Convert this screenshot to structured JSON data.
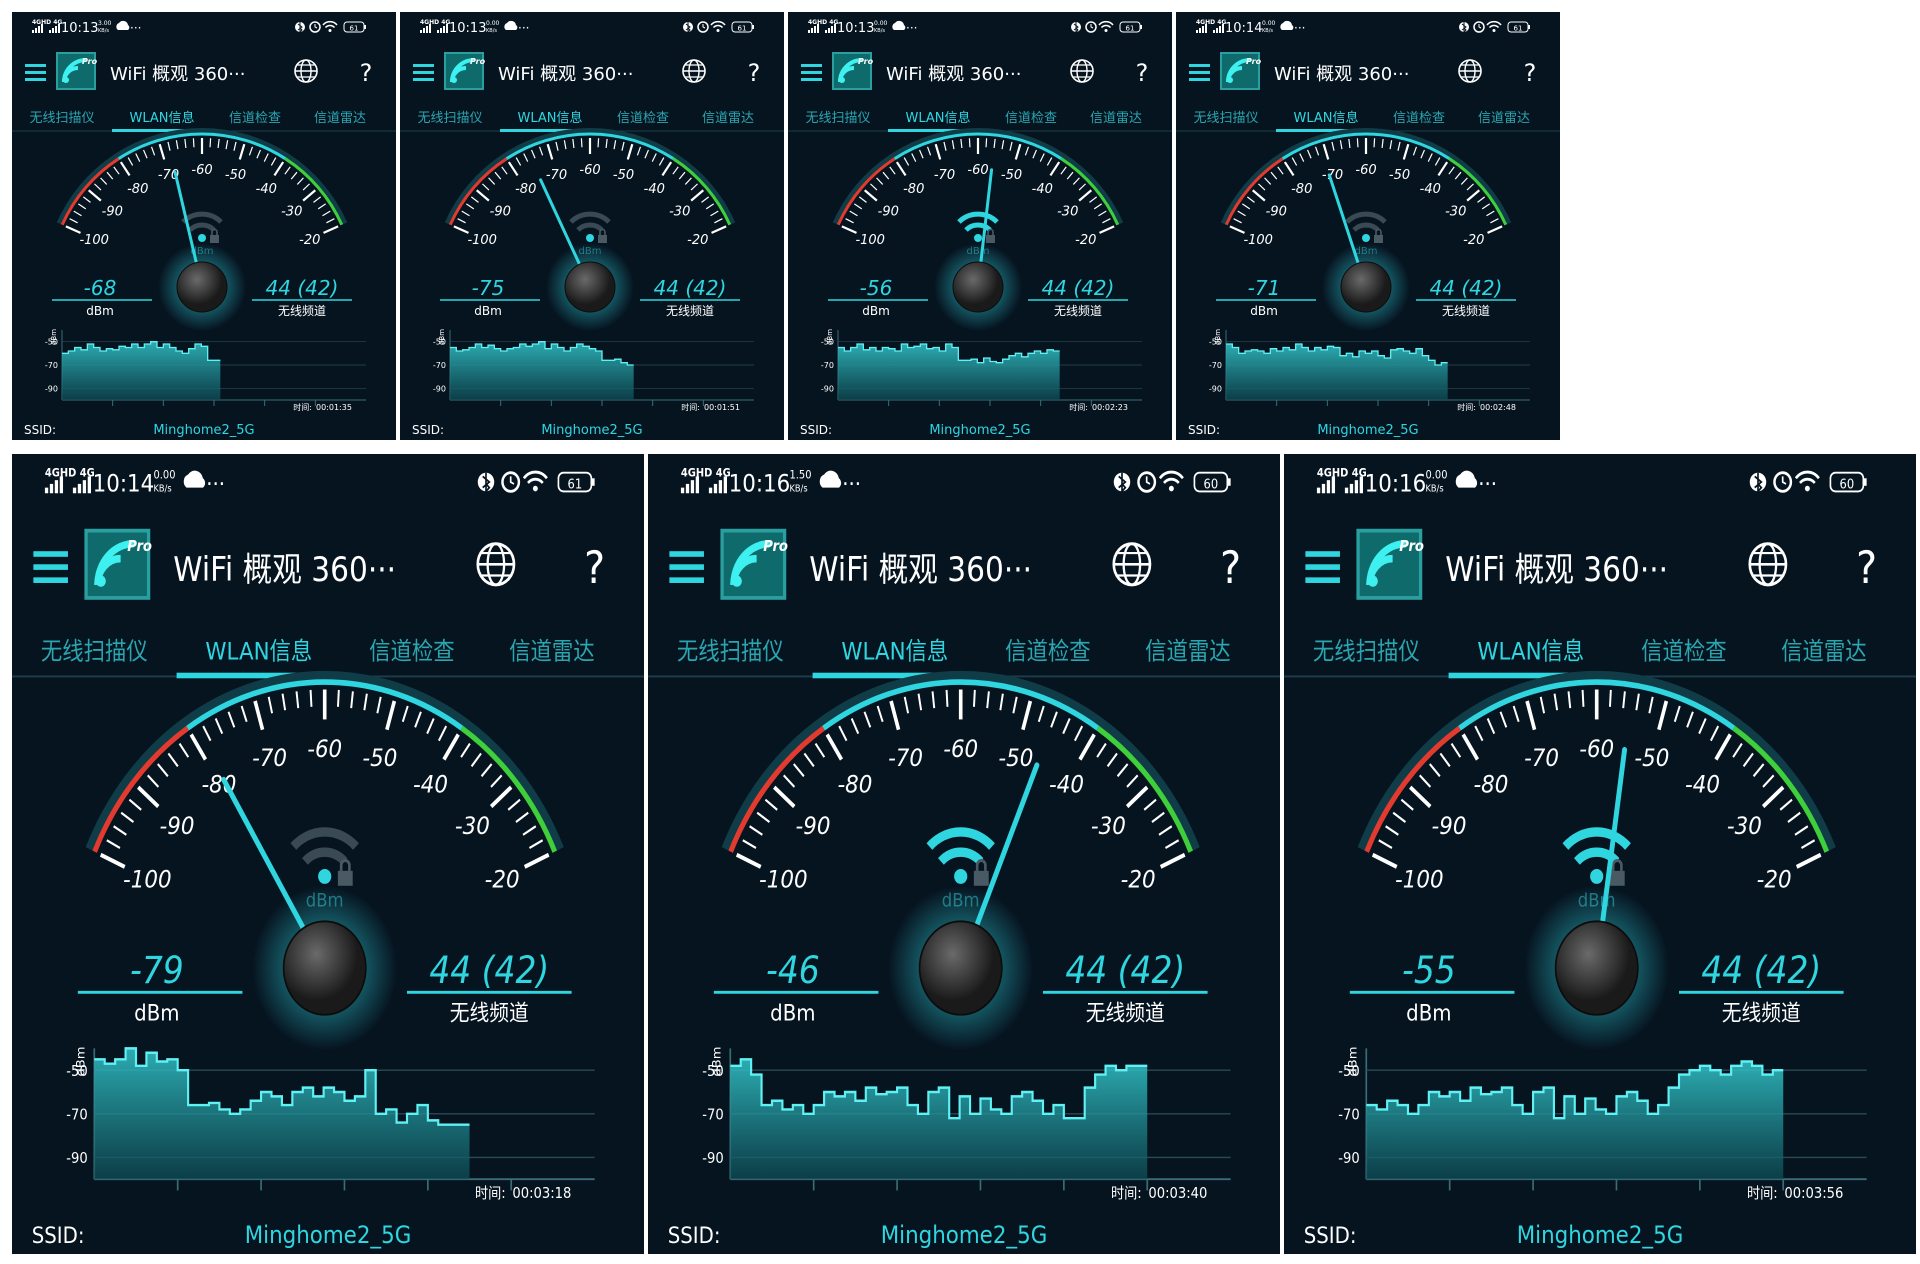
{
  "colors": {
    "bg": "#061420",
    "accent": "#2fd6e0",
    "red": "#e23a2e",
    "green": "#3ecf3a"
  },
  "app": {
    "title": "WiFi 概观 360···",
    "pro_badge": "Pro",
    "menu_icon": "hamburger-menu-icon",
    "globe_icon": "globe-icon",
    "help_label": "?",
    "tabs": [
      "无线扫描仪",
      "WLAN信息",
      "信道检查",
      "信道雷达"
    ],
    "active_tab": 1,
    "gauge_scale": [
      "-100",
      "-90",
      "-80",
      "-70",
      "-60",
      "-50",
      "-40",
      "-30",
      "-20"
    ],
    "gauge_unit": "dBm",
    "dbm_label": "dBm",
    "channel_label": "无线频道",
    "history_axis_unit": "dBm",
    "history_ticks": [
      "-50",
      "-70",
      "-90"
    ],
    "time_label": "时间:",
    "ssid_label": "SSID:",
    "ssid_value": "Minghome2_5G",
    "status_net": "4GHD 4G"
  },
  "panels": [
    {
      "time": "10:13",
      "speed": "3.00",
      "speed_unit": "KB/s",
      "battery": "61",
      "dbm": "-68",
      "channel": "44 (42)",
      "elapsed": "00:01:35",
      "wifi_level": 1,
      "history": [
        -60,
        -58,
        -55,
        -57,
        -52,
        -55,
        -58,
        -56,
        -57,
        -54,
        -55,
        -52,
        -55,
        -52,
        -50,
        -55,
        -52,
        -55,
        -58,
        -60,
        -56,
        -52,
        -54,
        -66,
        -66
      ]
    },
    {
      "time": "10:13",
      "speed": "0.00",
      "speed_unit": "KB/s",
      "battery": "61",
      "dbm": "-75",
      "channel": "44 (42)",
      "elapsed": "00:01:51",
      "wifi_level": 1,
      "history": [
        -55,
        -58,
        -57,
        -55,
        -52,
        -55,
        -53,
        -56,
        -58,
        -56,
        -55,
        -52,
        -54,
        -52,
        -50,
        -56,
        -52,
        -55,
        -58,
        -55,
        -52,
        -54,
        -56,
        -58,
        -66,
        -66,
        -65,
        -68,
        -70
      ]
    },
    {
      "time": "10:13",
      "speed": "0.00",
      "speed_unit": "KB/s",
      "battery": "61",
      "dbm": "-56",
      "channel": "44 (42)",
      "elapsed": "00:02:23",
      "wifi_level": 3,
      "history": [
        -55,
        -58,
        -55,
        -52,
        -57,
        -55,
        -58,
        -55,
        -56,
        -58,
        -52,
        -55,
        -54,
        -52,
        -56,
        -55,
        -58,
        -52,
        -55,
        -66,
        -66,
        -65,
        -68,
        -64,
        -67,
        -68,
        -65,
        -62,
        -60,
        -63,
        -60,
        -58,
        -60,
        -57,
        -58
      ]
    },
    {
      "time": "10:14",
      "speed": "0.00",
      "speed_unit": "KB/s",
      "battery": "61",
      "dbm": "-71",
      "channel": "44 (42)",
      "elapsed": "00:02:48",
      "wifi_level": 1,
      "history": [
        -52,
        -55,
        -60,
        -58,
        -57,
        -58,
        -60,
        -56,
        -58,
        -55,
        -57,
        -52,
        -55,
        -58,
        -55,
        -57,
        -54,
        -55,
        -62,
        -60,
        -63,
        -58,
        -60,
        -58,
        -62,
        -64,
        -57,
        -56,
        -58,
        -60,
        -56,
        -62,
        -66,
        -70,
        -68
      ]
    },
    {
      "time": "10:14",
      "speed": "0.00",
      "speed_unit": "KB/s",
      "battery": "61",
      "dbm": "-79",
      "channel": "44 (42)",
      "elapsed": "00:03:18",
      "wifi_level": 1,
      "history": [
        -45,
        -47,
        -45,
        -40,
        -48,
        -42,
        -46,
        -45,
        -50,
        -66,
        -66,
        -65,
        -68,
        -70,
        -68,
        -64,
        -60,
        -62,
        -66,
        -60,
        -58,
        -62,
        -58,
        -60,
        -64,
        -62,
        -50,
        -70,
        -68,
        -74,
        -70,
        -66,
        -73,
        -75,
        -75,
        -75
      ]
    },
    {
      "time": "10:16",
      "speed": "1.50",
      "speed_unit": "KB/s",
      "battery": "60",
      "dbm": "-46",
      "channel": "44 (42)",
      "elapsed": "00:03:40",
      "wifi_level": 3,
      "history": [
        -48,
        -45,
        -52,
        -66,
        -64,
        -68,
        -66,
        -70,
        -66,
        -60,
        -62,
        -60,
        -64,
        -58,
        -61,
        -60,
        -58,
        -66,
        -70,
        -60,
        -58,
        -72,
        -62,
        -70,
        -63,
        -68,
        -70,
        -62,
        -60,
        -64,
        -70,
        -66,
        -72,
        -72,
        -58,
        -52,
        -48,
        -50,
        -48,
        -48
      ]
    },
    {
      "time": "10:16",
      "speed": "0.00",
      "speed_unit": "KB/s",
      "battery": "60",
      "dbm": "-55",
      "channel": "44 (42)",
      "elapsed": "00:03:56",
      "wifi_level": 3,
      "history": [
        -66,
        -68,
        -64,
        -66,
        -70,
        -66,
        -60,
        -62,
        -60,
        -64,
        -58,
        -61,
        -60,
        -58,
        -66,
        -70,
        -60,
        -58,
        -72,
        -62,
        -70,
        -63,
        -68,
        -70,
        -62,
        -60,
        -64,
        -70,
        -66,
        -58,
        -52,
        -50,
        -48,
        -50,
        -52,
        -48,
        -46,
        -48,
        -52,
        -50
      ]
    }
  ]
}
